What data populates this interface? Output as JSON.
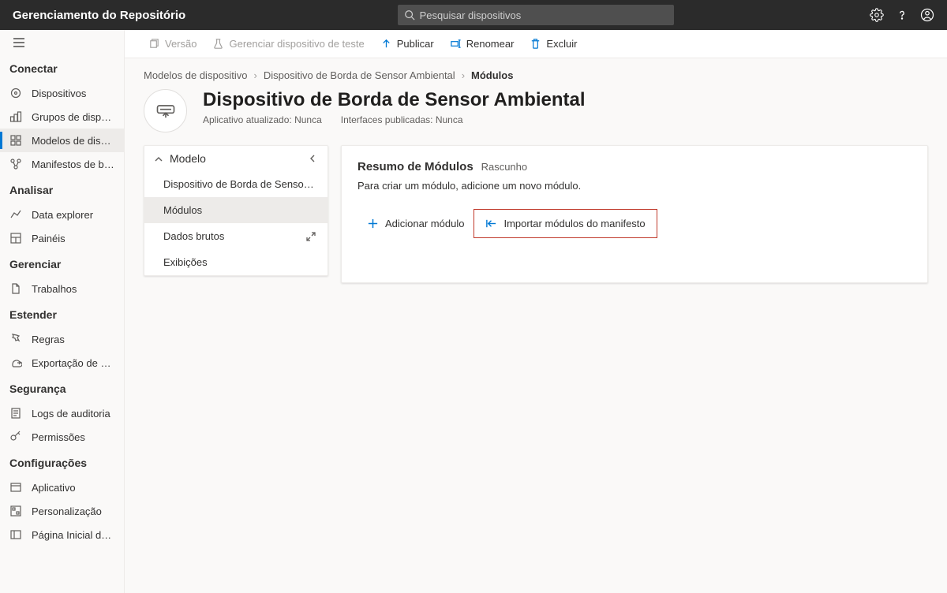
{
  "header": {
    "app_title": "Gerenciamento do Repositório",
    "search_placeholder": "Pesquisar dispositivos"
  },
  "sidebar": {
    "sections": [
      {
        "label": "Conectar",
        "items": [
          {
            "id": "devices",
            "label": "Dispositivos"
          },
          {
            "id": "device-groups",
            "label": "Grupos de dispositivos"
          },
          {
            "id": "device-templates",
            "label": "Modelos de disposit...",
            "selected": true
          },
          {
            "id": "edge-manifests",
            "label": "Manifestos de borda"
          }
        ]
      },
      {
        "label": "Analisar",
        "items": [
          {
            "id": "data-explorer",
            "label": "Data explorer"
          },
          {
            "id": "dashboards",
            "label": "Painéis"
          }
        ]
      },
      {
        "label": "Gerenciar",
        "items": [
          {
            "id": "jobs",
            "label": "Trabalhos"
          }
        ]
      },
      {
        "label": "Estender",
        "items": [
          {
            "id": "rules",
            "label": "Regras"
          },
          {
            "id": "data-export",
            "label": "Exportação de dados"
          }
        ]
      },
      {
        "label": "Segurança",
        "items": [
          {
            "id": "audit-logs",
            "label": "Logs de auditoria"
          },
          {
            "id": "permissions",
            "label": "Permissões"
          }
        ]
      },
      {
        "label": "Configurações",
        "items": [
          {
            "id": "application",
            "label": "Aplicativo"
          },
          {
            "id": "customization",
            "label": "Personalização"
          },
          {
            "id": "iot-homepage",
            "label": "Página Inicial do IoT C"
          }
        ]
      }
    ]
  },
  "commands": {
    "version": "Versão",
    "manage_test_device": "Gerenciar dispositivo de teste",
    "publish": "Publicar",
    "rename": "Renomear",
    "delete": "Excluir"
  },
  "breadcrumb": {
    "crumb1": "Modelos de dispositivo",
    "crumb2": "Dispositivo de Borda de Sensor Ambiental",
    "crumb3": "Módulos"
  },
  "title": {
    "page_title": "Dispositivo de Borda de Sensor Ambiental",
    "meta_updated": "Aplicativo atualizado: Nunca",
    "meta_published": "Interfaces publicadas: Nunca"
  },
  "model_panel": {
    "header": "Modelo",
    "items": [
      {
        "label": "Dispositivo de Borda de Sensor Am..."
      },
      {
        "label": "Módulos",
        "selected": true
      },
      {
        "label": "Dados brutos",
        "expandable": true
      },
      {
        "label": "Exibições"
      }
    ]
  },
  "modules_panel": {
    "title": "Resumo de Módulos",
    "badge": "Rascunho",
    "description": "Para criar um módulo, adicione um novo módulo.",
    "add_label": "Adicionar módulo",
    "import_label": "Importar módulos do manifesto"
  }
}
